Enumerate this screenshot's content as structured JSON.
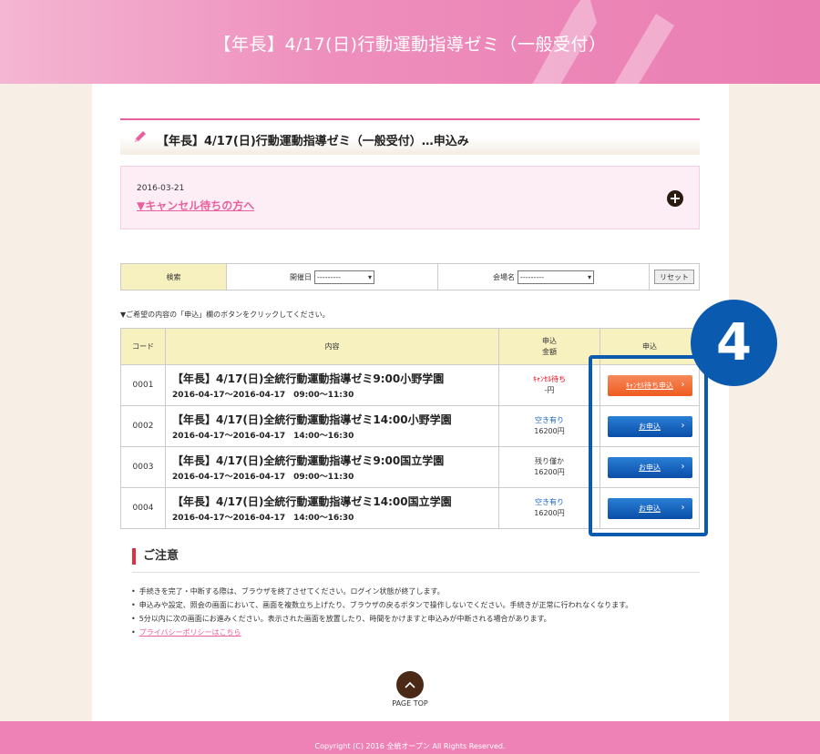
{
  "header": {
    "title": "【年長】4/17(日)行動運動指導ゼミ（一般受付）"
  },
  "section": {
    "title": "【年長】4/17(日)行動運動指導ゼミ（一般受付）…申込み"
  },
  "info": {
    "date": "2016-03-21",
    "link": "▼キャンセル待ちの方へ",
    "plus": "+"
  },
  "search": {
    "label": "検索",
    "date_label": "開催日",
    "date_value": "---------",
    "venue_label": "会場名",
    "venue_value": "---------",
    "reset": "リセット"
  },
  "instruction": "▼ご希望の内容の「申込」欄のボタンをクリックしてください。",
  "table": {
    "headers": {
      "code": "コード",
      "content": "内容",
      "status_1": "申込",
      "status_2": "金額",
      "apply": "申込"
    },
    "rows": [
      {
        "code": "0001",
        "title": "【年長】4/17(日)全統行動運動指導ゼミ9:00小野学園",
        "sub": "2016-04-17～2016-04-17　09:00～11:30",
        "status": "ｷｬﾝｾﾙ待ち",
        "price": "-円",
        "button": "ｷｬﾝｾﾙ待ち申込"
      },
      {
        "code": "0002",
        "title": "【年長】4/17(日)全統行動運動指導ゼミ14:00小野学園",
        "sub": "2016-04-17～2016-04-17　14:00～16:30",
        "status": "空き有り",
        "price": "16200円",
        "button": "お申込"
      },
      {
        "code": "0003",
        "title": "【年長】4/17(日)全統行動運動指導ゼミ9:00国立学園",
        "sub": "2016-04-17～2016-04-17　09:00～11:30",
        "status": "残り僅か",
        "price": "16200円",
        "button": "お申込"
      },
      {
        "code": "0004",
        "title": "【年長】4/17(日)全統行動運動指導ゼミ14:00国立学園",
        "sub": "2016-04-17～2016-04-17　14:00～16:30",
        "status": "空き有り",
        "price": "16200円",
        "button": "お申込"
      }
    ]
  },
  "badge": "4",
  "notice": {
    "title": "ご注意",
    "items": [
      "手続きを完了・中断する際は、ブラウザを終了させてください。ログイン状態が終了します。",
      "申込みや設定、照会の画面において、画面を複数立ち上げたり、ブラウザの戻るボタンで操作しないでください。手続きが正常に行われなくなります。",
      "5分以内に次の画面にお進みください。表示された画面を放置したり、時間をかけますと申込みが中断される場合があります。"
    ],
    "privacy_link": "プライバシーポリシーはこちら"
  },
  "pagetop": {
    "label": "PAGE TOP"
  },
  "footer": {
    "copyright": "Copyright (C) 2016 全統オープン All Rights Reserved."
  },
  "colors": {
    "pink": "#ea7db2",
    "blue": "#0a5bb0",
    "orange": "#ef5a1f",
    "red": "#e60012"
  },
  "icons": {
    "pencil": "pencil-icon",
    "chevron": "chevron-right-icon",
    "pagetop": "chevron-up-icon"
  }
}
